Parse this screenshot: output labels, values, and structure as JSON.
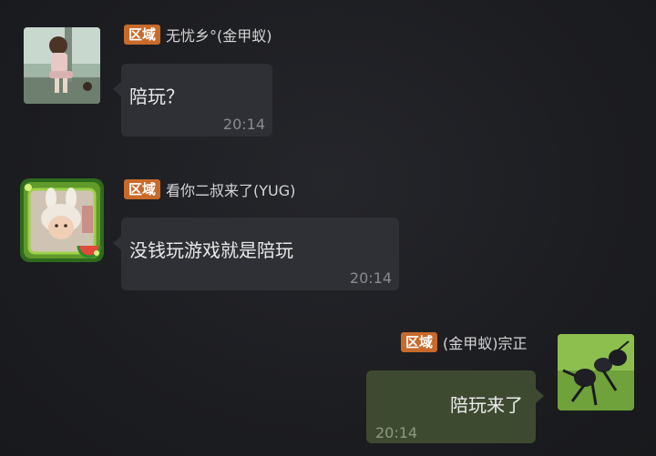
{
  "messages": [
    {
      "tag": "区域",
      "sender": "无忧乡°(金甲蚁)",
      "text": "陪玩？",
      "time": "20:14",
      "avatar": "girl-sitting-avatar"
    },
    {
      "tag": "区域",
      "sender": "看你二叔来了(YUG)",
      "text": "没钱玩游戏就是陪玩",
      "time": "20:14",
      "avatar": "child-bunny-hat-avatar"
    },
    {
      "tag": "区域",
      "sender": "(金甲蚁)宗正",
      "text": "陪玩来了",
      "time": "20:14",
      "avatar": "black-ant-avatar"
    }
  ],
  "colors": {
    "background": "#1b1c20",
    "bubble_incoming": "#2f3035",
    "bubble_outgoing": "#3d4a30",
    "tag": "#c86a2a"
  }
}
